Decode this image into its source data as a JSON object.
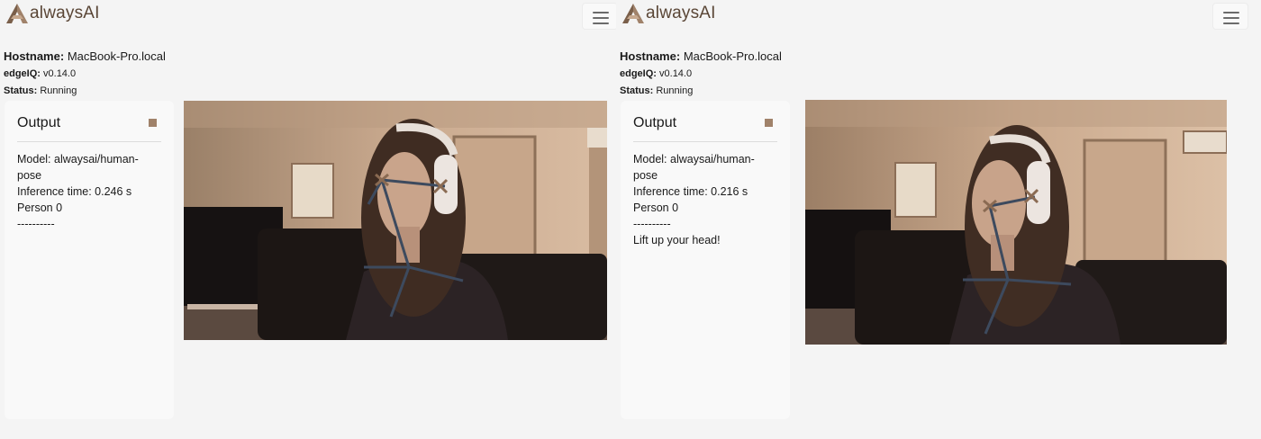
{
  "app": {
    "logo_text": "alwaysAI",
    "brand_color": "#a0826a"
  },
  "instances": [
    {
      "hostname_label": "Hostname:",
      "hostname_value": "MacBook-Pro.local",
      "edgeiq_label": "edgeIQ:",
      "edgeiq_value": "v0.14.0",
      "status_label": "Status:",
      "status_value": "Running",
      "output": {
        "title": "Output",
        "lines": [
          "Model: alwaysai/human-pose",
          "Inference time: 0.246 s",
          "Person 0",
          "----------"
        ]
      },
      "video_icon": "webcam-feed-image"
    },
    {
      "hostname_label": "Hostname:",
      "hostname_value": "MacBook-Pro.local",
      "edgeiq_label": "edgeIQ:",
      "edgeiq_value": "v0.14.0",
      "status_label": "Status:",
      "status_value": "Running",
      "output": {
        "title": "Output",
        "lines": [
          "Model: alwaysai/human-pose",
          "Inference time: 0.216 s",
          "Person 0",
          "----------",
          "Lift up your head!"
        ]
      },
      "video_icon": "webcam-feed-image"
    }
  ]
}
